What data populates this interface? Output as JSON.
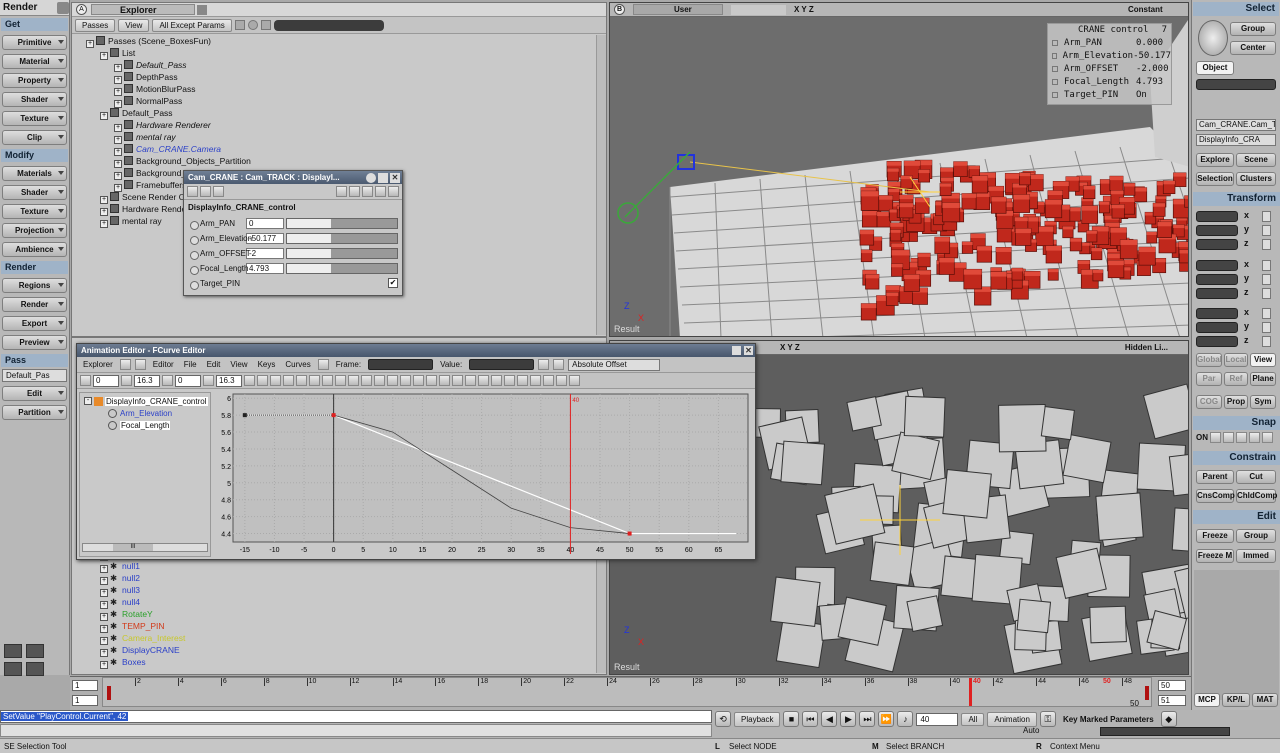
{
  "left_panel": {
    "mode": "Render",
    "sections": [
      {
        "header": "Get",
        "buttons": [
          "Primitive",
          "Material",
          "Property",
          "Shader",
          "Texture",
          "Clip"
        ]
      },
      {
        "header": "Modify",
        "buttons": [
          "Materials",
          "Shader",
          "Texture",
          "Projection",
          "Ambience"
        ]
      },
      {
        "header": "Render",
        "buttons": [
          "Regions",
          "Render",
          "Export",
          "Preview"
        ]
      },
      {
        "header": "Pass",
        "buttons": [
          "Edit",
          "Partition"
        ]
      }
    ],
    "pass_select": "Default_Pas"
  },
  "explorer": {
    "title_letter": "A",
    "title": "Explorer",
    "toolbar": [
      "Passes",
      "View",
      "All Except Params"
    ],
    "tree": [
      {
        "label": "Passes (Scene_BoxesFun)",
        "indent": 0,
        "color": "#111",
        "italic": false
      },
      {
        "label": "List",
        "indent": 1,
        "color": "#111",
        "italic": false
      },
      {
        "label": "Default_Pass",
        "indent": 2,
        "color": "#111",
        "italic": true
      },
      {
        "label": "DepthPass",
        "indent": 2,
        "color": "#111",
        "italic": false
      },
      {
        "label": "MotionBlurPass",
        "indent": 2,
        "color": "#111",
        "italic": false
      },
      {
        "label": "NormalPass",
        "indent": 2,
        "color": "#111",
        "italic": false
      },
      {
        "label": "Default_Pass",
        "indent": 1,
        "color": "#111",
        "italic": false
      },
      {
        "label": "Hardware Renderer",
        "indent": 2,
        "color": "#111",
        "italic": true
      },
      {
        "label": "mental ray",
        "indent": 2,
        "color": "#111",
        "italic": true
      },
      {
        "label": "Cam_CRANE.Camera",
        "indent": 2,
        "color": "#2a3fc8",
        "italic": true
      },
      {
        "label": "Background_Objects_Partition",
        "indent": 2,
        "color": "#111",
        "italic": false
      },
      {
        "label": "Background_Lig",
        "indent": 2,
        "color": "#111",
        "italic": false
      },
      {
        "label": "Framebuffers",
        "indent": 2,
        "color": "#111",
        "italic": false
      },
      {
        "label": "Scene Render Opti",
        "indent": 1,
        "color": "#111",
        "italic": false
      },
      {
        "label": "Hardware Rendere",
        "indent": 1,
        "color": "#111",
        "italic": false
      },
      {
        "label": "mental ray",
        "indent": 1,
        "color": "#111",
        "italic": false
      }
    ],
    "tree_lower": [
      {
        "label": "DisplayInfo_CRANE_control",
        "color": "#111"
      },
      {
        "label": "null1",
        "color": "#2a3fc8"
      },
      {
        "label": "null2",
        "color": "#2a3fc8"
      },
      {
        "label": "null3",
        "color": "#2a3fc8"
      },
      {
        "label": "null4",
        "color": "#2a3fc8"
      },
      {
        "label": "RotateY",
        "color": "#2aa02a"
      },
      {
        "label": "TEMP_PIN",
        "color": "#d13a1a"
      },
      {
        "label": "Camera_Interest",
        "color": "#c8c82a"
      },
      {
        "label": "DisplayCRANE",
        "color": "#2a3fc8"
      },
      {
        "label": "Boxes",
        "color": "#2a3fc8"
      }
    ]
  },
  "property_panel": {
    "title": "Cam_CRANE : Cam_TRACK : DisplayI...",
    "section": "DisplayInfo_CRANE_control",
    "rows": [
      {
        "label": "Arm_PAN",
        "value": "0"
      },
      {
        "label": "Arm_Elevation",
        "value": "-50.177"
      },
      {
        "label": "Arm_OFFSET",
        "value": "-2"
      },
      {
        "label": "Focal_Length",
        "value": "4.793"
      }
    ],
    "pin_label": "Target_PIN",
    "pin_check": "✔"
  },
  "viewport_top": {
    "letter": "B",
    "camera": "User",
    "axes": "X Y Z",
    "mode": "Constant",
    "label": "Result",
    "info": {
      "title": "CRANE control",
      "number": "7",
      "rows": [
        {
          "k": "Arm_PAN",
          "v": "0.000"
        },
        {
          "k": "Arm_Elevation",
          "v": "-50.177"
        },
        {
          "k": "Arm_OFFSET",
          "v": "-2.000"
        },
        {
          "k": "Focal_Length",
          "v": "4.793"
        },
        {
          "k": "Target_PIN",
          "v": "On"
        }
      ]
    }
  },
  "viewport_bottom": {
    "axes": "X Y Z",
    "mode": "Hidden Li...",
    "label": "Result"
  },
  "anim_editor": {
    "title": "Animation Editor - FCurve Editor",
    "menu": [
      "Explorer",
      "Editor",
      "File",
      "Edit",
      "View",
      "Keys",
      "Curves"
    ],
    "frame_label": "Frame:",
    "value_label": "Value:",
    "offset_mode": "Absolute Offset",
    "field1": "0",
    "field2": "16.3",
    "field3": "0",
    "field4": "16.3",
    "tree_root": "DisplayInfo_CRANE_control",
    "tree_items": [
      {
        "label": "Arm_Elevation",
        "color": "#2a3fc8"
      },
      {
        "label": "Focal_Length",
        "color": "#111"
      }
    ],
    "scroll_grip": "III",
    "marker_label": "40"
  },
  "chart_data": {
    "type": "line",
    "x_ticks": [
      -15,
      -10,
      -5,
      0,
      5,
      10,
      15,
      20,
      25,
      30,
      35,
      40,
      45,
      50,
      55,
      60,
      65
    ],
    "y_ticks": [
      4.4,
      4.6,
      4.8,
      5.0,
      5.2,
      5.4,
      5.6,
      5.8,
      6.0
    ],
    "xlim": [
      -17,
      70
    ],
    "ylim": [
      4.3,
      6.05
    ],
    "current_frame": 40,
    "series": [
      {
        "name": "",
        "type": "fcurve",
        "color": "#ffffff",
        "points": [
          [
            -15,
            5.8
          ],
          [
            0,
            5.8
          ],
          [
            50,
            4.4
          ],
          [
            68,
            4.4
          ]
        ]
      },
      {
        "name": "",
        "type": "smooth",
        "color": "#444444",
        "points": [
          [
            0,
            5.8
          ],
          [
            10,
            5.6
          ],
          [
            20,
            5.15
          ],
          [
            30,
            4.7
          ],
          [
            40,
            4.47
          ],
          [
            50,
            4.4
          ]
        ]
      }
    ],
    "keys": [
      [
        -15,
        5.8
      ],
      [
        0,
        5.8
      ],
      [
        50,
        4.4
      ]
    ]
  },
  "right_panel": {
    "header": "Select",
    "group": "Group",
    "center": "Center",
    "object": "Object",
    "name1": "Cam_CRANE.Cam_T",
    "name2": "DisplayInfo_CRA",
    "explore": "Explore",
    "scene": "Scene",
    "selection": "Selection",
    "clusters": "Clusters",
    "transform": "Transform",
    "sxyz": [
      "x",
      "y",
      "z"
    ],
    "global": "Global",
    "local": "Local",
    "view": "View",
    "par": "Par",
    "ref": "Ref",
    "plane": "Plane",
    "cog": "COG",
    "prop": "Prop",
    "sym": "Sym",
    "snap": "Snap",
    "on": "ON",
    "constrain": "Constrain",
    "parent": "Parent",
    "cut": "Cut",
    "cnscomp": "CnsComp",
    "chldcomp": "ChldComp",
    "edit": "Edit",
    "freeze": "Freeze",
    "group2": "Group",
    "freezem": "Freeze M",
    "immed": "Immed"
  },
  "timeline": {
    "start": "1",
    "start2": "1",
    "end": "50",
    "end2": "50",
    "end3": "51",
    "ticks": [
      "2",
      "4",
      "6",
      "8",
      "10",
      "12",
      "14",
      "16",
      "18",
      "20",
      "22",
      "24",
      "26",
      "28",
      "30",
      "32",
      "34",
      "36",
      "38",
      "40",
      "42",
      "44",
      "46",
      "48"
    ],
    "current": "40",
    "current_right": "50"
  },
  "bottom": {
    "command": "SetValue \"PlayControl.Current\", 42",
    "playback": "Playback",
    "frame": "40",
    "all": "All",
    "animation": "Animation",
    "auto": "Auto",
    "key_marked": "Key Marked Parameters",
    "mcp": "MCP",
    "kpl": "KP/L",
    "mat": "MAT"
  },
  "status": {
    "tool": "SE Selection Tool",
    "l": "L",
    "select_node": "Select NODE",
    "m": "M",
    "select_branch": "Select BRANCH",
    "r": "R",
    "context_menu": "Context Menu"
  },
  "colors": {
    "accent": "#9fb3c8",
    "box_red": "#c0281c",
    "grid": "#dcdcdc"
  }
}
